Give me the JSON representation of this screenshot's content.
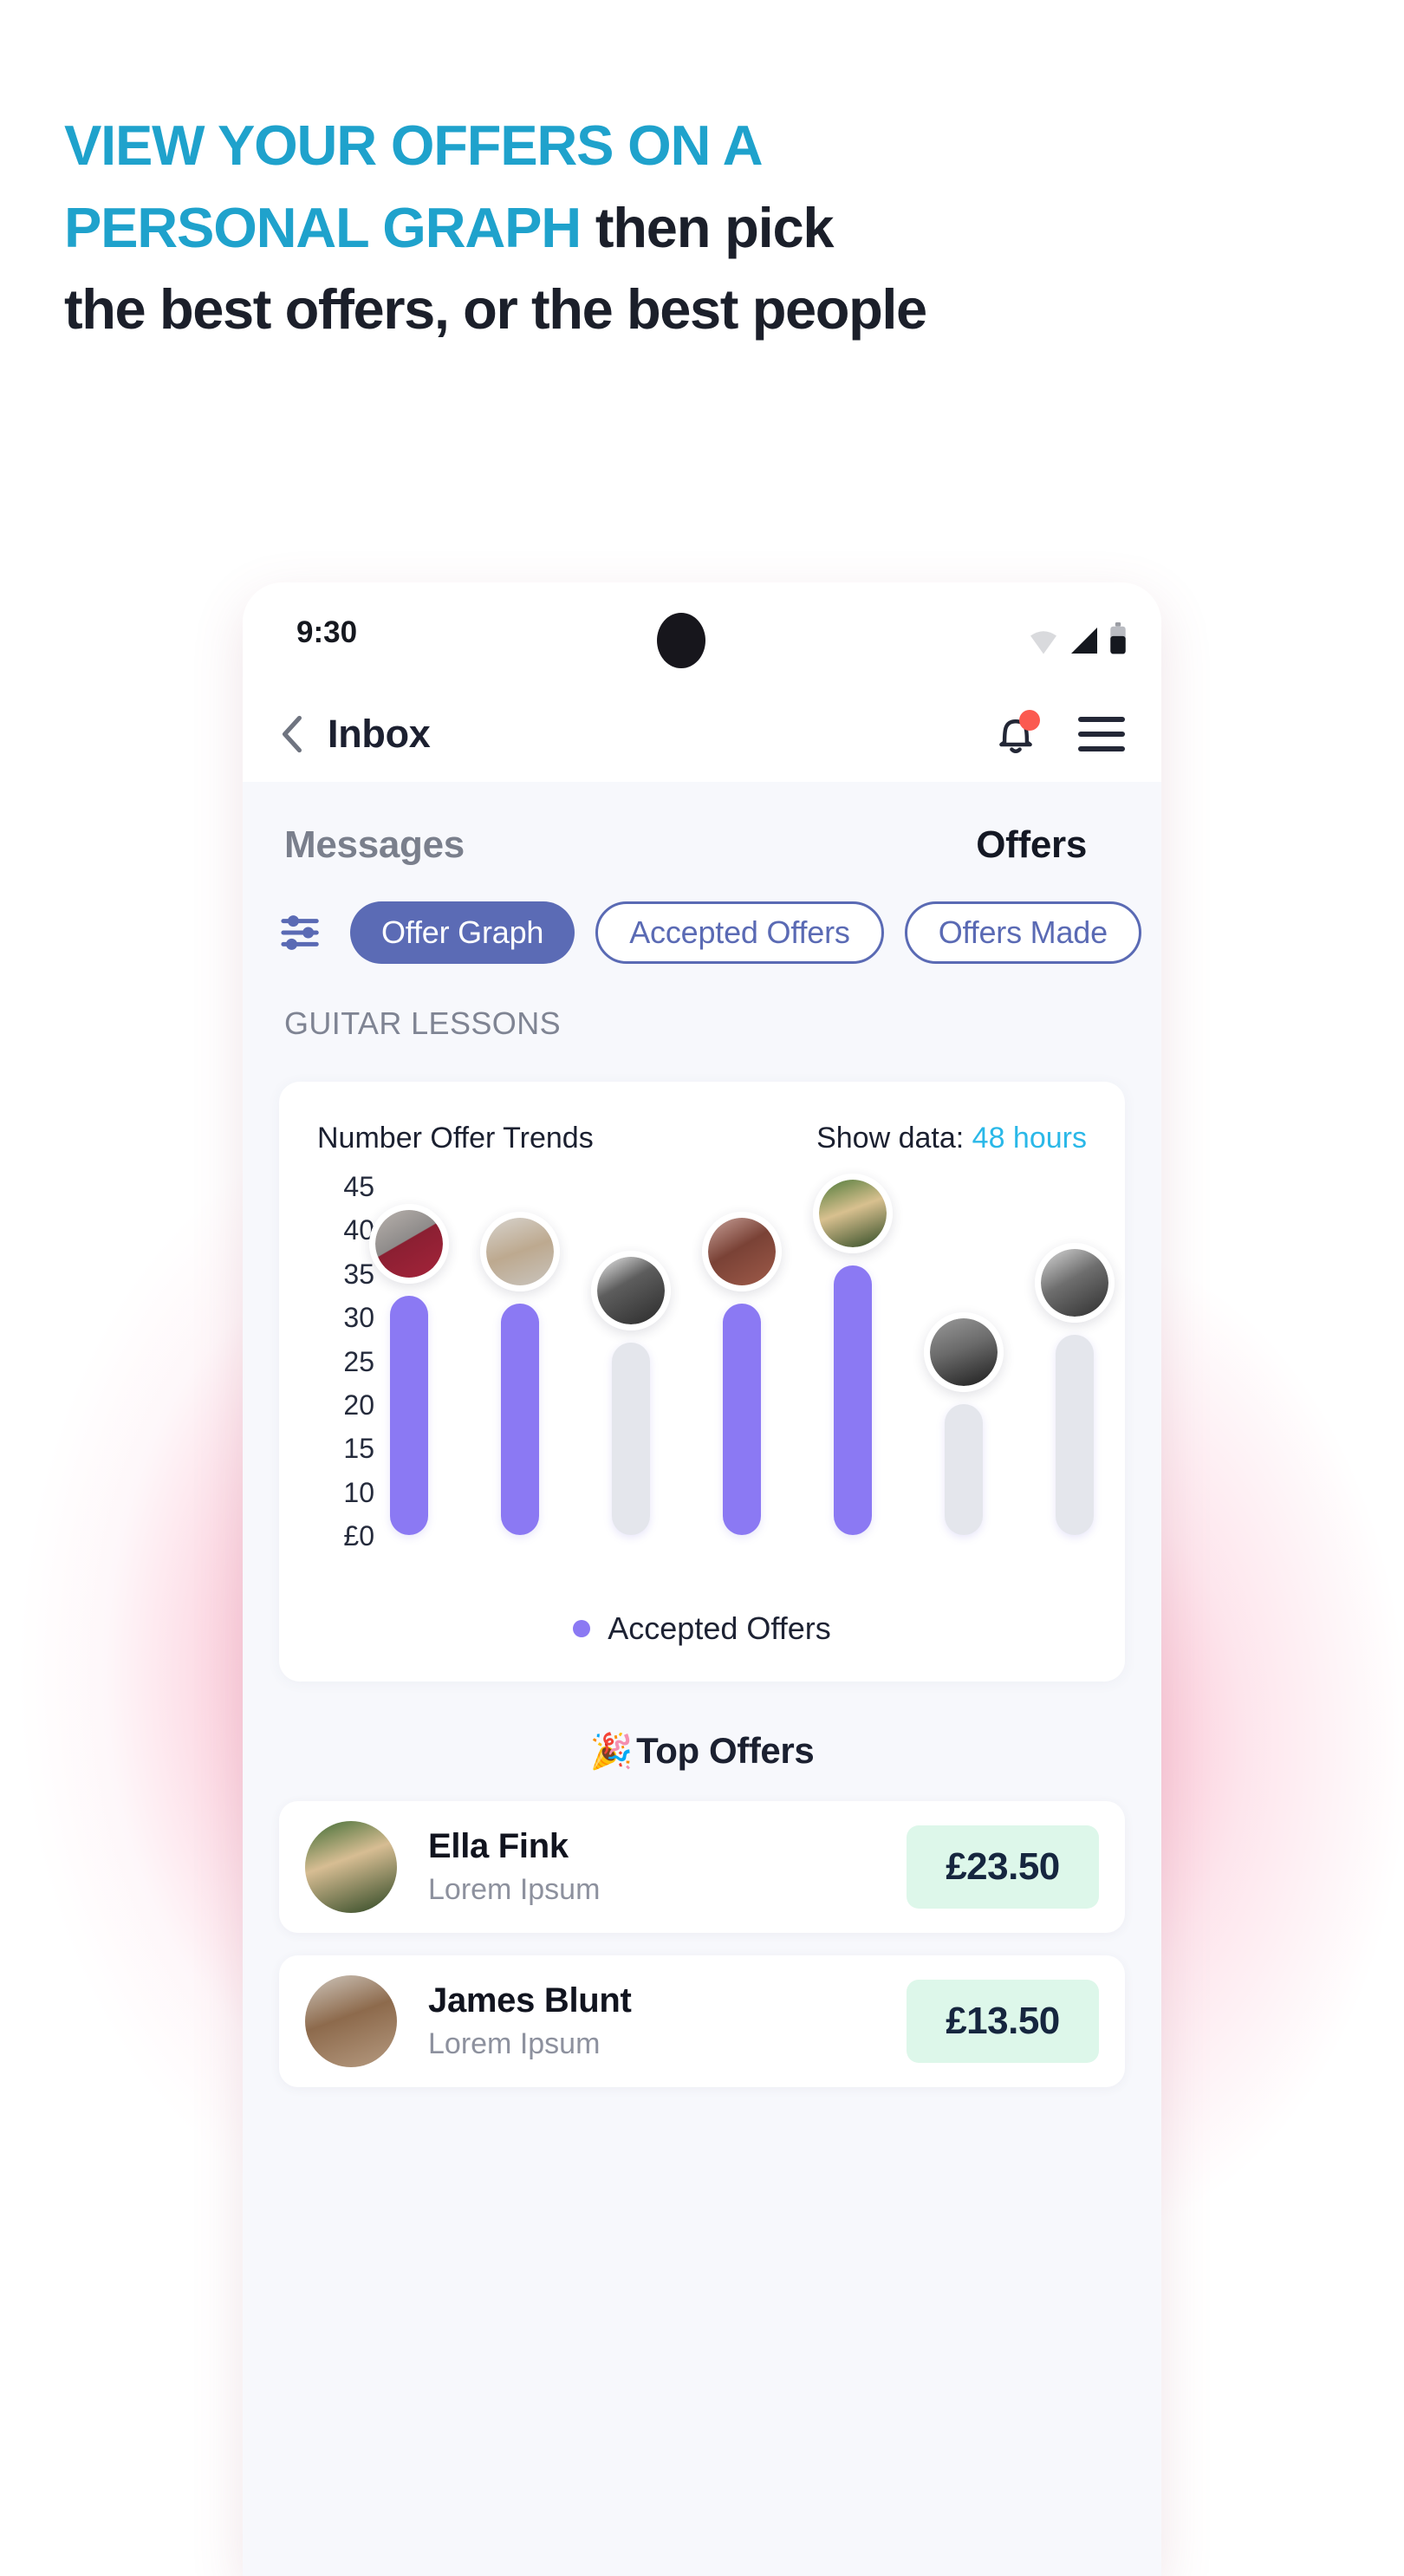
{
  "headline": {
    "line1_accent": "VIEW YOUR OFFERS ON A",
    "line2_accent": "PERSONAL GRAPH",
    "line2_rest": " then pick",
    "line3": "the best offers, or the best people",
    "accent_color": "#1fa2cc",
    "dark_color": "#1b1f2a"
  },
  "phone": {
    "status": {
      "time": "9:30",
      "wifi_icon": "wifi-icon",
      "signal_icon": "signal-icon",
      "battery_icon": "battery-icon"
    },
    "appbar": {
      "back_icon": "back-chevron-icon",
      "title": "Inbox",
      "bell_icon": "bell-icon",
      "bell_badge": "notification-badge",
      "menu_icon": "hamburger-menu-icon"
    },
    "segments": [
      {
        "label": "Messages",
        "active": false
      },
      {
        "label": "Offers",
        "active": true
      }
    ],
    "filter_icon": "filter-sliders-icon",
    "chips": [
      {
        "label": "Offer Graph",
        "selected": true
      },
      {
        "label": "Accepted Offers",
        "selected": false
      },
      {
        "label": "Offers Made",
        "selected": false
      }
    ],
    "category_label": "GUITAR LESSONS",
    "chart_card": {
      "title": "Number Offer Trends",
      "show_data_label": "Show data:",
      "show_data_value": "48 hours",
      "legend_label": "Accepted Offers"
    },
    "top_offers": {
      "emoji": "🎉",
      "title": "Top Offers",
      "rows": [
        {
          "name": "Ella Fink",
          "subtitle": "Lorem Ipsum",
          "price": "£23.50",
          "avatar": "avatar-ella-fink"
        },
        {
          "name": "James Blunt",
          "subtitle": "Lorem Ipsum",
          "price": "£13.50",
          "avatar": "avatar-james-blunt"
        }
      ]
    }
  },
  "chart_data": {
    "type": "bar",
    "title": "Number Offer Trends",
    "xlabel": "",
    "ylabel": "",
    "ylim": [
      0,
      45
    ],
    "ytick_labels": [
      "45",
      "40",
      "35",
      "30",
      "25",
      "20",
      "15",
      "10",
      "£0"
    ],
    "yticks": [
      45,
      40,
      35,
      30,
      25,
      20,
      15,
      10,
      0
    ],
    "grid": false,
    "legend": [
      {
        "label": "Accepted Offers",
        "color": "#8b79f3"
      }
    ],
    "legend_position": "bottom-center",
    "categories": [
      "p1",
      "p2",
      "p3",
      "p4",
      "p5",
      "p6",
      "p7"
    ],
    "values": [
      31,
      30,
      25,
      30,
      35,
      17,
      26
    ],
    "series": [
      {
        "name": "Offers",
        "values": [
          31,
          30,
          25,
          30,
          35,
          17,
          26
        ],
        "accepted": [
          true,
          true,
          false,
          true,
          true,
          false,
          false
        ],
        "bar_colors": [
          "#8b79f3",
          "#8b79f3",
          "#e4e6ec",
          "#8b79f3",
          "#8b79f3",
          "#e4e6ec",
          "#e4e6ec"
        ]
      }
    ],
    "point_avatars": [
      "avatar-1",
      "avatar-2",
      "avatar-3",
      "avatar-4",
      "avatar-5",
      "avatar-6",
      "avatar-7"
    ]
  }
}
